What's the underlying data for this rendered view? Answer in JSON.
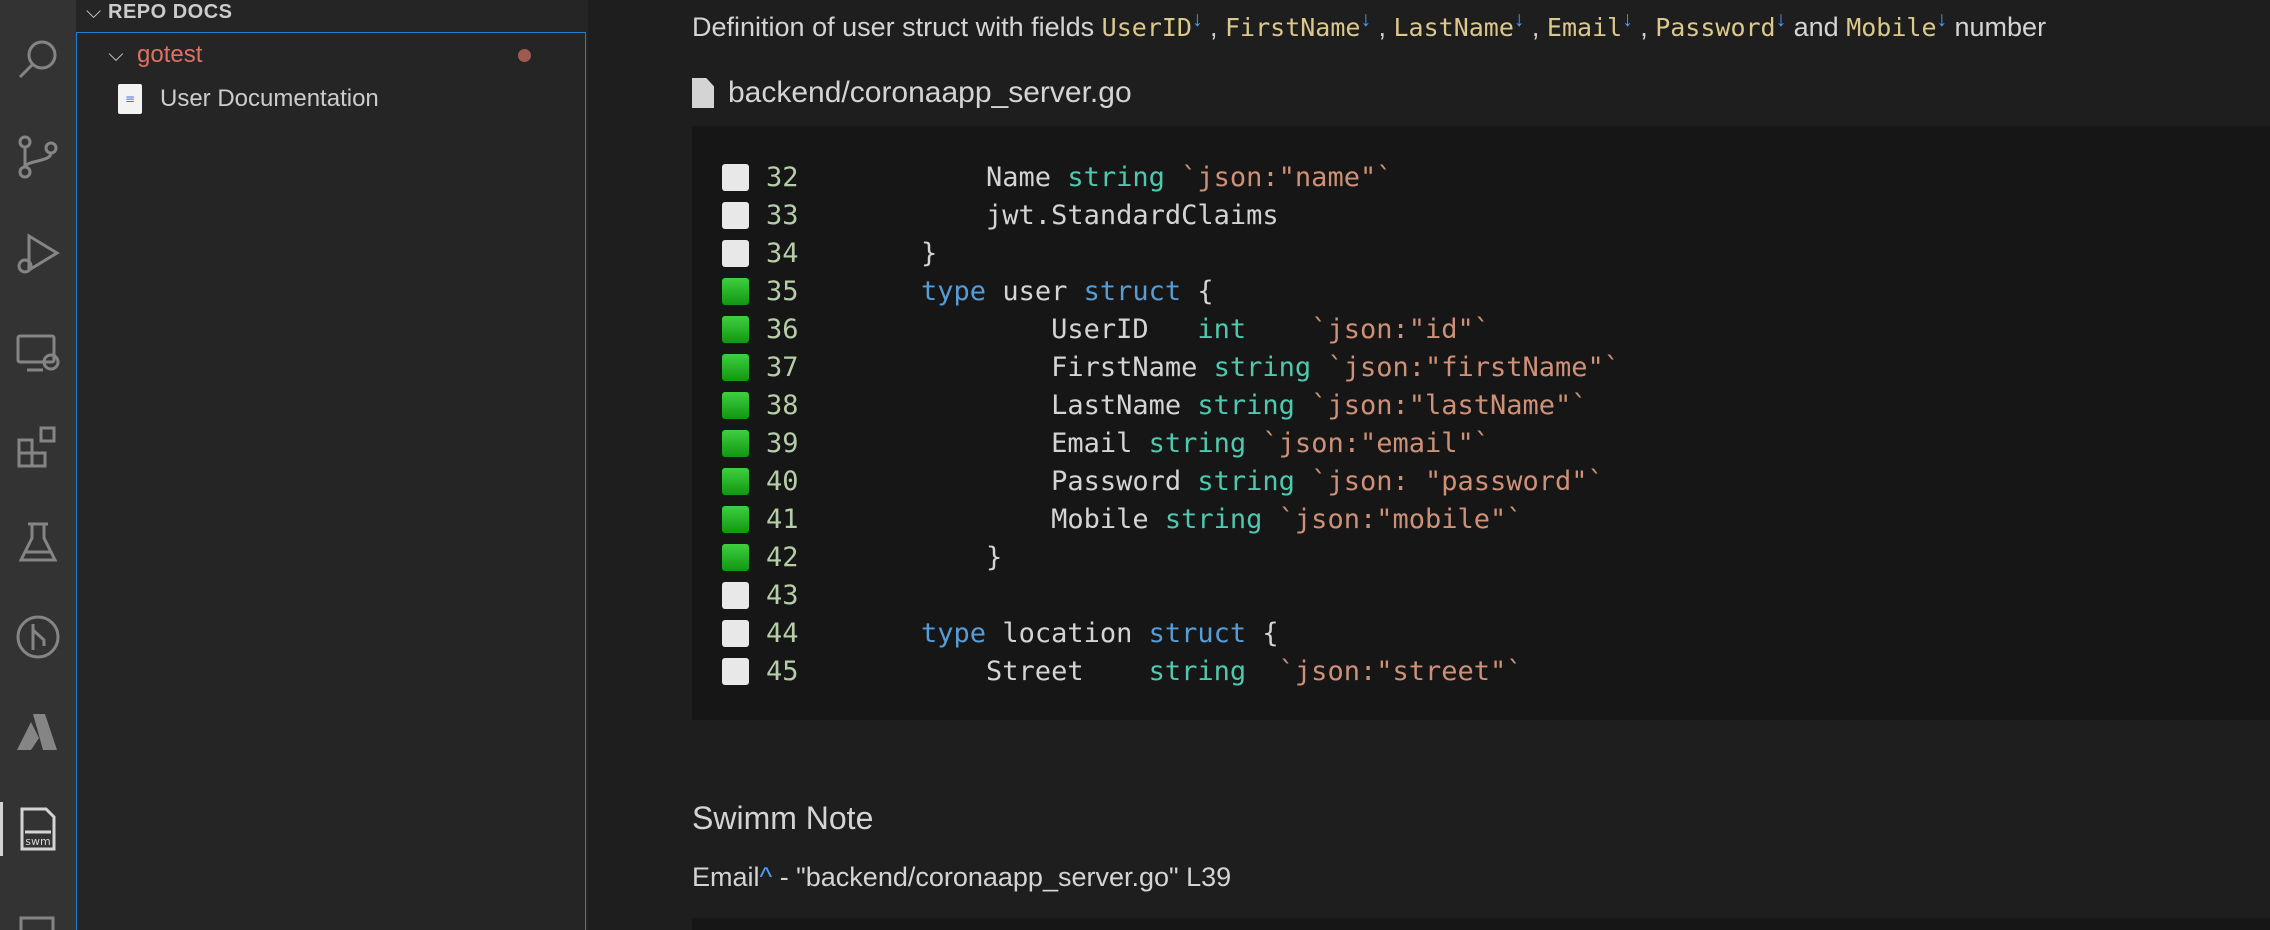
{
  "sidebar": {
    "section_title": "REPO DOCS",
    "folder": {
      "name": "gotest",
      "modified_dot_color": "#a05a52"
    },
    "file": {
      "name": "User Documentation"
    }
  },
  "activity_bar": {
    "items": [
      {
        "icon": "search-icon"
      },
      {
        "icon": "source-control-icon"
      },
      {
        "icon": "run-debug-icon"
      },
      {
        "icon": "remote-explorer-icon"
      },
      {
        "icon": "extensions-icon"
      },
      {
        "icon": "testing-icon"
      },
      {
        "icon": "git-graph-icon"
      },
      {
        "icon": "azure-icon"
      },
      {
        "icon": "swimm-icon",
        "label": "swm",
        "active": true
      },
      {
        "icon": "panel-icon"
      }
    ]
  },
  "main": {
    "description": {
      "before": "Definition of user struct with fields ",
      "fields": [
        "UserID",
        "FirstName",
        "LastName",
        "Email",
        "Password"
      ],
      "and_text": "and",
      "last_field": "Mobile",
      "tail": "number",
      "separator": ",",
      "arrow": "↓"
    },
    "file_path": "backend/coronaapp_server.go",
    "code_lines": [
      {
        "num": "32",
        "checked": false,
        "tokens": [
          [
            "",
            "        Name "
          ],
          [
            "t",
            "string"
          ],
          [
            "",
            " "
          ],
          [
            "s",
            "`json:\"name\"`"
          ]
        ]
      },
      {
        "num": "33",
        "checked": false,
        "tokens": [
          [
            "",
            "        jwt.StandardClaims"
          ]
        ]
      },
      {
        "num": "34",
        "checked": false,
        "tokens": [
          [
            "",
            "    }"
          ]
        ]
      },
      {
        "num": "35",
        "checked": true,
        "tokens": [
          [
            "",
            "    "
          ],
          [
            "k",
            "type"
          ],
          [
            "",
            " user "
          ],
          [
            "k",
            "struct"
          ],
          [
            "",
            " {"
          ]
        ]
      },
      {
        "num": "36",
        "checked": true,
        "tokens": [
          [
            "",
            "            UserID   "
          ],
          [
            "t",
            "int"
          ],
          [
            "",
            "    "
          ],
          [
            "s",
            "`json:\"id\"`"
          ]
        ]
      },
      {
        "num": "37",
        "checked": true,
        "tokens": [
          [
            "",
            "            FirstName "
          ],
          [
            "t",
            "string"
          ],
          [
            "",
            " "
          ],
          [
            "s",
            "`json:\"firstName\"`"
          ]
        ]
      },
      {
        "num": "38",
        "checked": true,
        "tokens": [
          [
            "",
            "            LastName "
          ],
          [
            "t",
            "string"
          ],
          [
            "",
            " "
          ],
          [
            "s",
            "`json:\"lastName\"`"
          ]
        ]
      },
      {
        "num": "39",
        "checked": true,
        "tokens": [
          [
            "",
            "            Email "
          ],
          [
            "t",
            "string"
          ],
          [
            "",
            " "
          ],
          [
            "s",
            "`json:\"email\"`"
          ]
        ]
      },
      {
        "num": "40",
        "checked": true,
        "tokens": [
          [
            "",
            "            Password "
          ],
          [
            "t",
            "string"
          ],
          [
            "",
            " "
          ],
          [
            "s",
            "`json: \"password\"`"
          ]
        ]
      },
      {
        "num": "41",
        "checked": true,
        "tokens": [
          [
            "",
            "            Mobile "
          ],
          [
            "t",
            "string"
          ],
          [
            "",
            " "
          ],
          [
            "s",
            "`json:\"mobile\"`"
          ]
        ]
      },
      {
        "num": "42",
        "checked": true,
        "tokens": [
          [
            "",
            "        }"
          ]
        ]
      },
      {
        "num": "43",
        "checked": false,
        "tokens": [
          [
            "",
            ""
          ]
        ]
      },
      {
        "num": "44",
        "checked": false,
        "tokens": [
          [
            "",
            "    "
          ],
          [
            "k",
            "type"
          ],
          [
            "",
            " location "
          ],
          [
            "k",
            "struct"
          ],
          [
            "",
            " {"
          ]
        ]
      },
      {
        "num": "45",
        "checked": false,
        "tokens": [
          [
            "",
            "        Street    "
          ],
          [
            "t",
            "string"
          ],
          [
            "",
            "  "
          ],
          [
            "s",
            "`json:\"street\"`"
          ]
        ]
      }
    ],
    "note": {
      "title": "Swimm Note",
      "token": "Email",
      "caret": "^",
      "rest": " - \"backend/coronaapp_server.go\" L39"
    }
  }
}
